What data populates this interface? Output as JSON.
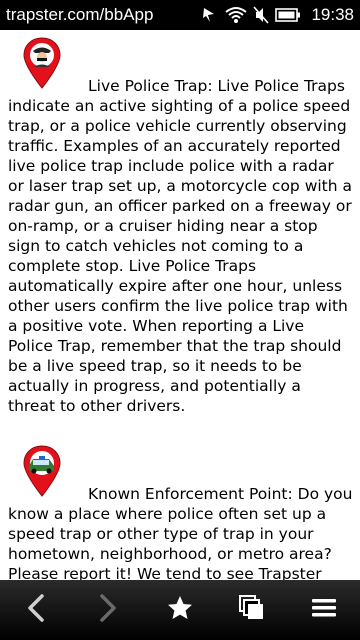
{
  "status_bar": {
    "url": "trapster.com/bbApp",
    "time": "19:38",
    "icons": [
      "download-icon",
      "wifi-icon",
      "mute-icon",
      "battery-icon"
    ]
  },
  "entries": [
    {
      "term": "Live Police Trap:",
      "first_line": "Live Police Traps",
      "body": "indicate an active sighting of a police speed trap, or a police vehicle currently observing traffic. Examples of an accurately reported live police trap include police with a radar or laser trap set up, a motorcycle cop with a radar gun, an officer parked on a freeway or on-ramp, or a cruiser hiding near a stop sign to catch vehicles not coming to a complete stop. Live Police Traps automatically expire after one hour, unless other users confirm the live police trap with a positive vote. When reporting a Live Police Trap, remember that the trap should be a live speed trap, so it needs to be actually in progress, and potentially a threat to other drivers.",
      "icon": "police-officer-pin-icon"
    },
    {
      "term": "Known Enforcement Point:",
      "first_line": "Do you",
      "body": "know a place where police often set up a speed trap or other type of trap in your hometown, neighborhood, or metro area? Please report it! We tend to see Trapster users reporting hiding spots in abundance",
      "icon": "police-car-pin-icon"
    }
  ],
  "toolbar": {
    "buttons": [
      "back-icon",
      "forward-icon",
      "bookmark-star-icon",
      "windows-icon",
      "menu-icon"
    ]
  }
}
